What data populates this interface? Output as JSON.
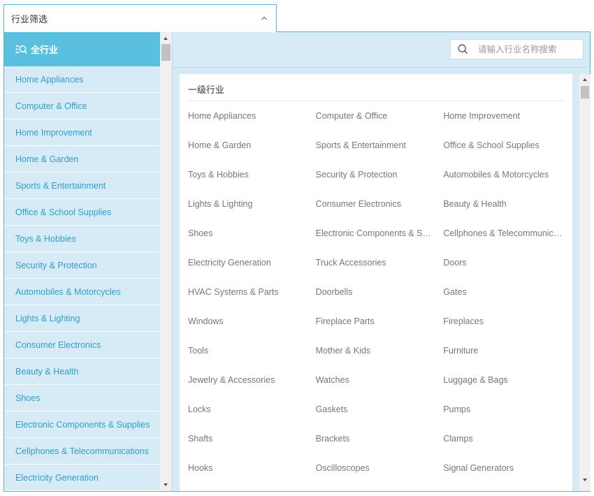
{
  "select": {
    "label": "行业筛选"
  },
  "sidebar": {
    "all_label": "全行业",
    "items": [
      "Home Appliances",
      "Computer & Office",
      "Home Improvement",
      "Home & Garden",
      "Sports & Entertainment",
      "Office & School Supplies",
      "Toys & Hobbies",
      "Security & Protection",
      "Automobiles & Motorcycles",
      "Lights & Lighting",
      "Consumer Electronics",
      "Beauty & Health",
      "Shoes",
      "Electronic Components & Supplies",
      "Cellphones & Telecommunications",
      "Electricity Generation"
    ]
  },
  "search": {
    "placeholder": "请输入行业名称搜索"
  },
  "main": {
    "heading": "一级行业",
    "rows": [
      [
        "Home Appliances",
        "Computer & Office",
        "Home Improvement"
      ],
      [
        "Home & Garden",
        "Sports & Entertainment",
        "Office & School Supplies"
      ],
      [
        "Toys & Hobbies",
        "Security & Protection",
        "Automobiles & Motorcycles"
      ],
      [
        "Lights & Lighting",
        "Consumer Electronics",
        "Beauty & Health"
      ],
      [
        "Shoes",
        "Electronic Components & Supplies",
        "Cellphones & Telecommunications"
      ],
      [
        "Electricity Generation",
        "Truck Accessories",
        "Doors"
      ],
      [
        "HVAC Systems & Parts",
        "Doorbells",
        "Gates"
      ],
      [
        "Windows",
        "Fireplace Parts",
        "Fireplaces"
      ],
      [
        "Tools",
        "Mother & Kids",
        "Furniture"
      ],
      [
        "Jewelry & Accessories",
        "Watches",
        "Luggage & Bags"
      ],
      [
        "Locks",
        "Gaskets",
        "Pumps"
      ],
      [
        "Shafts",
        "Brackets",
        "Clamps"
      ],
      [
        "Hooks",
        "Oscilloscopes",
        "Signal Generators"
      ]
    ]
  },
  "icons": {
    "chevron": "chevron-up-icon",
    "all": "list-search-icon",
    "search": "search-icon"
  },
  "colors": {
    "accent": "#5bbfdf",
    "panel_bg": "#d6ebf5",
    "link": "#2e9ed0",
    "border": "#5ab4d6"
  }
}
